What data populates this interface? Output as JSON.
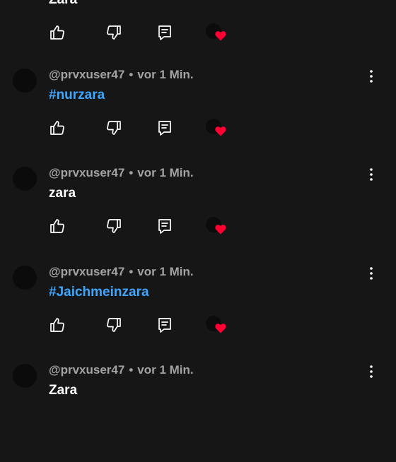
{
  "partial_top_comment": {
    "text": "Zara",
    "icons": [
      "thumbs-up-icon",
      "thumbs-down-icon",
      "reply-icon",
      "creator-heart-icon"
    ]
  },
  "comments": [
    {
      "author": "@prvxuser47",
      "separator": "•",
      "time": "vor 1 Min.",
      "text": "#nurzara",
      "is_hashtag": true
    },
    {
      "author": "@prvxuser47",
      "separator": "•",
      "time": "vor 1 Min.",
      "text": "zara",
      "is_hashtag": false
    },
    {
      "author": "@prvxuser47",
      "separator": "•",
      "time": "vor 1 Min.",
      "text": "#Jaichmeinzara",
      "is_hashtag": true
    },
    {
      "author": "@prvxuser47",
      "separator": "•",
      "time": "vor 1 Min.",
      "text": "Zara",
      "is_hashtag": false
    }
  ],
  "colors": {
    "background": "#161616",
    "meta_text": "#a3a3a3",
    "hashtag": "#3ea6ff",
    "heart": "#ff0033",
    "icon": "#ffffff"
  }
}
